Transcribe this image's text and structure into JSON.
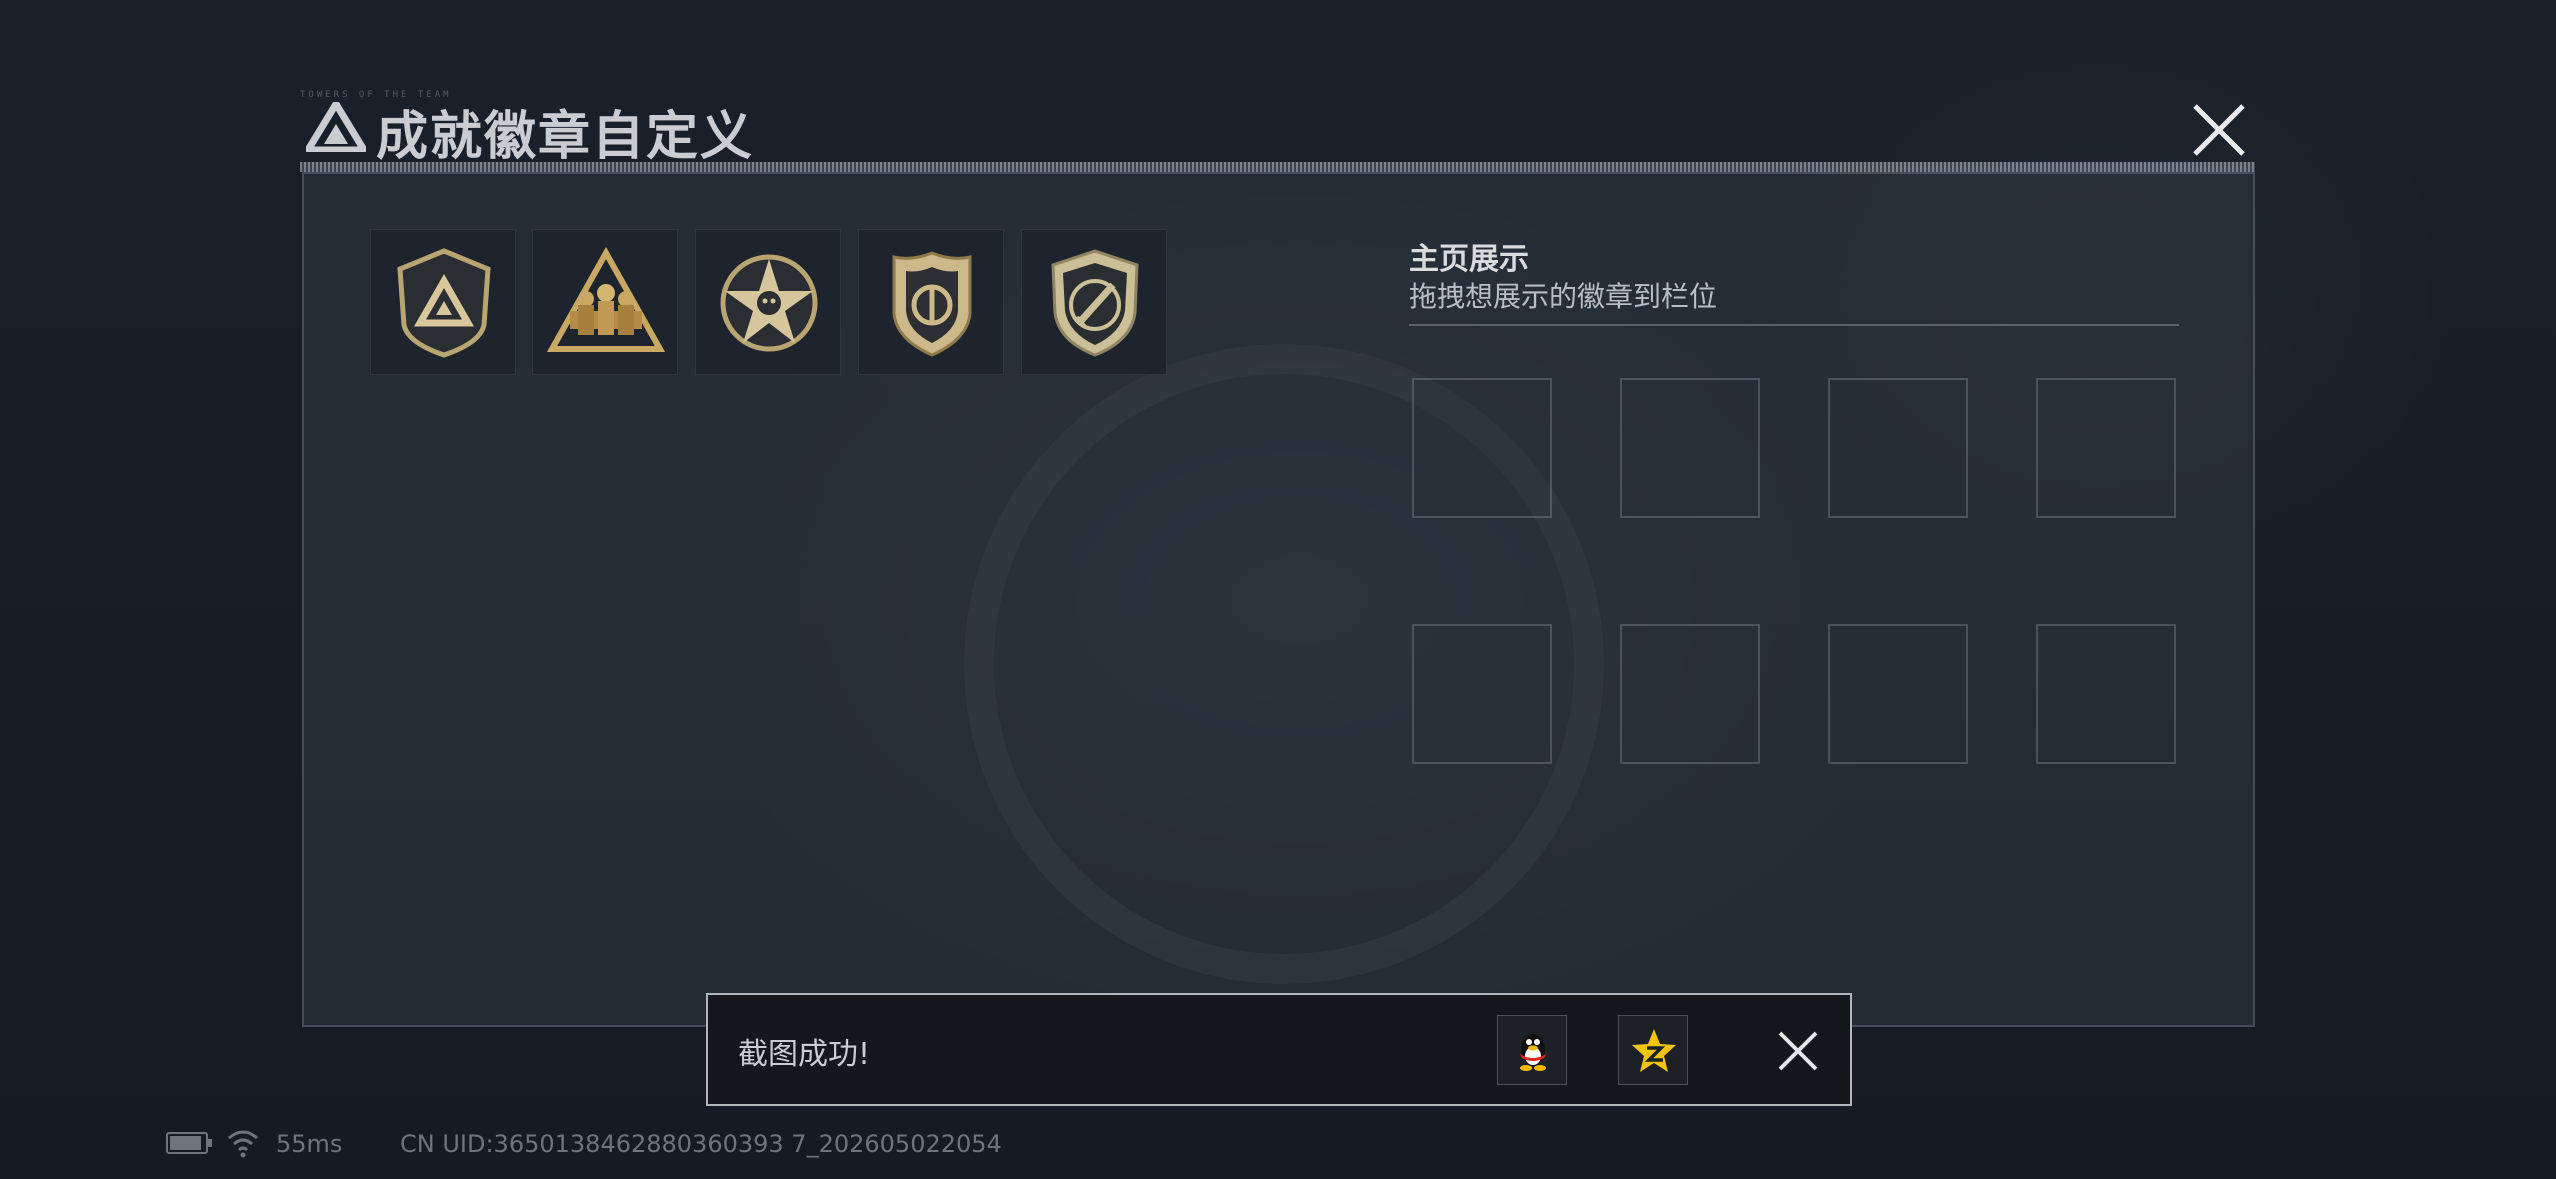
{
  "window": {
    "caption_tiny": "TOWERS OF THE TEAM",
    "title": "成就徽章自定义"
  },
  "badges": [
    {
      "icon": "shield-triangle-badge-icon"
    },
    {
      "icon": "soldiers-triangle-badge-icon"
    },
    {
      "icon": "star-skull-badge-icon"
    },
    {
      "icon": "police-shield-badge-icon"
    },
    {
      "icon": "knife-shield-badge-icon"
    }
  ],
  "showcase": {
    "title": "主页展示",
    "subtitle": "拖拽想展示的徽章到栏位",
    "slot_count": 8
  },
  "toast": {
    "message": "截图成功!",
    "share_qq_icon": "qq-penguin-icon",
    "share_qzone_icon": "qzone-star-icon"
  },
  "status": {
    "battery_level": 0.9,
    "ping": "55ms",
    "uid": "CN UID:3650138462880360393 7_202605022054"
  },
  "colors": {
    "background": "#161c24",
    "panel": "#30384280",
    "badge_gold": "#c8b27a",
    "toast_border": "#b0b5ba"
  }
}
